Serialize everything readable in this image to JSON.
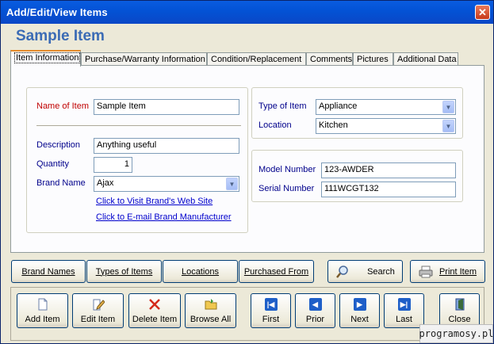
{
  "window": {
    "title": "Add/Edit/View Items",
    "close_glyph": "✕"
  },
  "heading": "Sample Item",
  "tabs": [
    {
      "label": "Item Information",
      "active": true
    },
    {
      "label": "Purchase/Warranty Information"
    },
    {
      "label": "Condition/Replacement"
    },
    {
      "label": "Comments"
    },
    {
      "label": "Pictures"
    },
    {
      "label": "Additional Data"
    }
  ],
  "item_info": {
    "name_label": "Name of Item",
    "name_value": "Sample Item",
    "description_label": "Description",
    "description_value": "Anything useful",
    "quantity_label": "Quantity",
    "quantity_value": "1",
    "brand_label": "Brand Name",
    "brand_value": "Ajax",
    "visit_brand_link": "Click to Visit Brand's Web Site",
    "email_brand_link": "Click to E-mail Brand Manufacturer",
    "type_label": "Type of Item",
    "type_value": "Appliance",
    "location_label": "Location",
    "location_value": "Kitchen",
    "model_label": "Model Number",
    "model_value": "123-AWDER",
    "serial_label": "Serial Number",
    "serial_value": "111WCGT132"
  },
  "list_buttons": {
    "brand_names": "Brand Names",
    "types_of_items": "Types of Items",
    "locations": "Locations",
    "purchased_from": "Purchased From",
    "search": "Search",
    "print_item": "Print Item"
  },
  "nav_buttons": {
    "add_item": "Add Item",
    "edit_item": "Edit Item",
    "delete_item": "Delete Item",
    "browse_all": "Browse All",
    "first": "First",
    "prior": "Prior",
    "next": "Next",
    "last": "Last",
    "close": "Close"
  },
  "watermark": "programosy.pl",
  "icons": {
    "add": "document-icon",
    "edit": "pencil-icon",
    "delete": "red-x-icon",
    "browse": "folder-icon",
    "first": "first-record-icon",
    "prior": "prior-record-icon",
    "next": "next-record-icon",
    "last": "last-record-icon",
    "close": "exit-door-icon",
    "search": "magnifier-icon",
    "print": "printer-icon"
  },
  "colors": {
    "title_bar": "#0353d6",
    "heading": "#3b6bb5",
    "tab_active_accent": "#e68b2c",
    "link": "#0000cc",
    "required_label": "#c00000"
  }
}
